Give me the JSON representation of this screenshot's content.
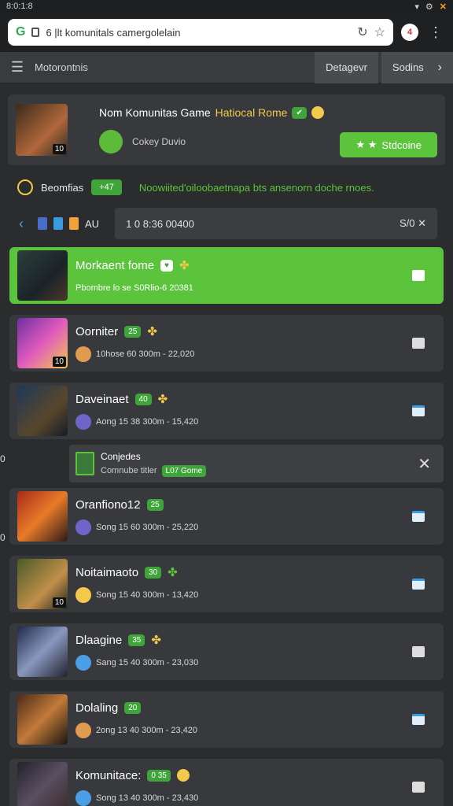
{
  "status": {
    "time": "8:0:1:8"
  },
  "browser": {
    "url": "6 |lt komunitals camergolelain",
    "notif_count": "4"
  },
  "nav": {
    "title": "Motorontnis",
    "btn1": "Detagevr",
    "btn2": "Sodins"
  },
  "hero": {
    "title": "Nom Komunitas Game",
    "title_hl": "Hatiocal Rome",
    "sub": "Cokey Duvio",
    "avatar_badge": "10",
    "btn": "Stdcoine"
  },
  "stats": {
    "label": "Beomfias",
    "chip": "+47",
    "message": "Noowiited'oiloobaetnapa bts ansenorn doche rnoes."
  },
  "filter": {
    "tag": "AU",
    "search": "1 0 8:36 00400",
    "right": "S/0 ✕"
  },
  "rows": [
    {
      "name": "Morkaent fome",
      "meta": "Pbombre lo se S0Rlio-6 20381",
      "badge": "",
      "chip": ""
    },
    {
      "name": "Oorniter",
      "meta": "10hose 60 300m - 22,020",
      "badge": "10",
      "chip": "25"
    },
    {
      "name": "Daveinaet",
      "meta": "Aong 15 38 300m - 15,420",
      "badge": "",
      "chip": "40"
    },
    {
      "name": "Oranfiono12",
      "meta": "Song 15 60 300m - 25,220",
      "badge": "",
      "chip": "25"
    },
    {
      "name": "Noitaimaoto",
      "meta": "Song 15 40 300m - 13,420",
      "badge": "10",
      "chip": "30"
    },
    {
      "name": "Dlaagine",
      "meta": "Sang 15 40 300m - 23,030",
      "badge": "",
      "chip": "35"
    },
    {
      "name": "Dolaling",
      "meta": "2ong 13 40 300m - 23,420",
      "badge": "",
      "chip": "20"
    },
    {
      "name": "Komunitace:",
      "meta": "Song 13 40 300m - 23,430",
      "badge": "",
      "chip": "0 35"
    }
  ],
  "toast": {
    "title": "Conjedes",
    "sub": "Comnube titler",
    "chip": "L07 Gome"
  },
  "side_marks": [
    "0",
    "0"
  ]
}
